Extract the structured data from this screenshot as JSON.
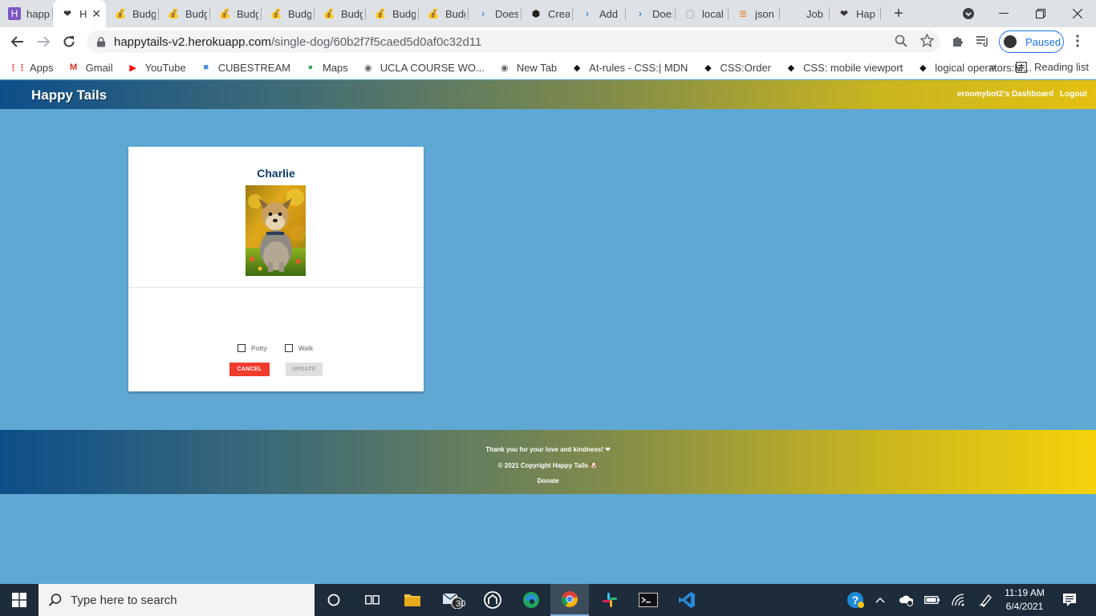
{
  "browser": {
    "tabs": [
      {
        "title": "happ",
        "icon": "h-icon",
        "color": "#7e57c2"
      },
      {
        "title": "H",
        "icon": "paw-heart-icon",
        "color": "#333333"
      },
      {
        "title": "Budg",
        "icon": "money-bag-icon",
        "color": "#222222"
      },
      {
        "title": "Budg",
        "icon": "money-bag-icon",
        "color": "#222222"
      },
      {
        "title": "Budg",
        "icon": "money-bag-icon",
        "color": "#222222"
      },
      {
        "title": "Budg",
        "icon": "money-bag-icon",
        "color": "#222222"
      },
      {
        "title": "Budg",
        "icon": "money-bag-icon",
        "color": "#222222"
      },
      {
        "title": "Budg",
        "icon": "money-bag-icon",
        "color": "#222222"
      },
      {
        "title": "Budg",
        "icon": "money-bag-icon",
        "color": "#222222"
      },
      {
        "title": "Does",
        "icon": "terminal-icon",
        "color": "#1565c0"
      },
      {
        "title": "Crea",
        "icon": "codesandbox-icon",
        "color": "#222222"
      },
      {
        "title": "Add",
        "icon": "terminal-icon",
        "color": "#1565c0"
      },
      {
        "title": "Does",
        "icon": "terminal-icon",
        "color": "#1565c0"
      },
      {
        "title": "local",
        "icon": "blank-page-icon",
        "color": "#9e9e9e"
      },
      {
        "title": "json",
        "icon": "stackoverflow-icon",
        "color": "#f48024"
      },
      {
        "title": "Job",
        "icon": "blank-icon",
        "color": "#dee1e6"
      },
      {
        "title": "Hap",
        "icon": "paw-heart-icon",
        "color": "#333333"
      }
    ],
    "active_tab_index": 1,
    "url_host": "happytails-v2.herokuapp.com",
    "url_path": "/single-dog/60b2f7f5caed5d0af0c32d11",
    "profile_status": "Paused",
    "bookmarks": [
      {
        "label": "Apps",
        "icon": "apps-grid-icon"
      },
      {
        "label": "Gmail",
        "icon": "gmail-icon"
      },
      {
        "label": "YouTube",
        "icon": "youtube-icon"
      },
      {
        "label": "CUBESTREAM",
        "icon": "cube-icon"
      },
      {
        "label": "Maps",
        "icon": "maps-pin-icon"
      },
      {
        "label": "UCLA COURSE WO...",
        "icon": "globe-icon"
      },
      {
        "label": "New Tab",
        "icon": "globe-icon"
      },
      {
        "label": "At-rules - CSS:| MDN",
        "icon": "codepen-icon"
      },
      {
        "label": "CSS:Order",
        "icon": "codepen-icon"
      },
      {
        "label": "CSS: mobile viewport",
        "icon": "codepen-icon"
      },
      {
        "label": "logical operators:M...",
        "icon": "codepen-icon"
      }
    ],
    "more_bookmarks": "»",
    "reading_list": "Reading list"
  },
  "site": {
    "brand": "Happy Tails",
    "dashboard_link": "eroomybot2's Dashboard",
    "logout_link": "Logout"
  },
  "dog_card": {
    "name": "Charlie",
    "potty_label": "Potty",
    "walk_label": "Walk",
    "potty_checked": false,
    "walk_checked": false,
    "cancel_label": "CANCEL",
    "update_label": "UPDATE"
  },
  "footer": {
    "line1": "Thank you for your love and kindness! ❤",
    "line2": "© 2021 Copyright Happy Tails 🐶",
    "donate": "Donate"
  },
  "taskbar": {
    "search_placeholder": "Type here to search",
    "mail_badge": "30",
    "time": "11:19 AM",
    "date": "6/4/2021"
  }
}
